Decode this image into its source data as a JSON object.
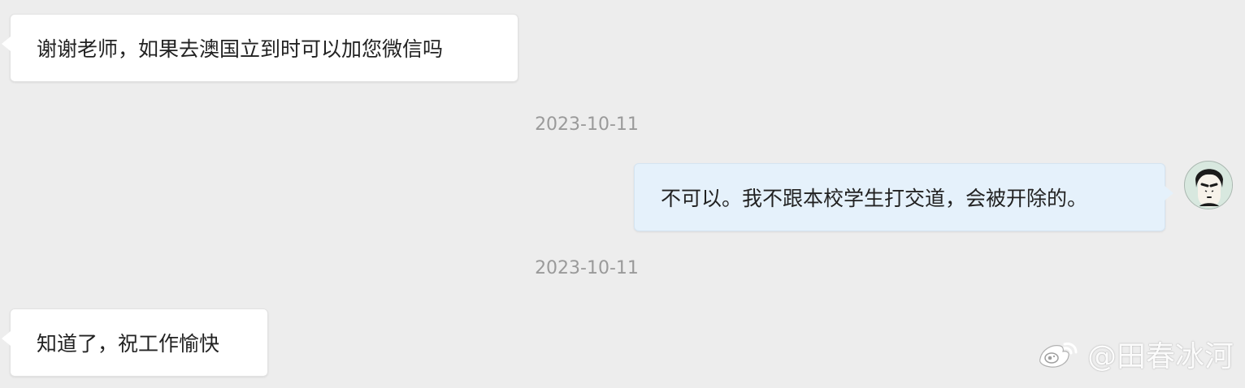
{
  "chat": {
    "messages": [
      {
        "text": "谢谢老师，如果去澳国立到时可以加您微信吗"
      },
      {
        "text": "不可以。我不跟本校学生打交道，会被开除的。"
      },
      {
        "text": "知道了，祝工作愉快"
      }
    ],
    "timestamps": [
      "2023-10-11",
      "2023-10-11"
    ]
  },
  "watermark": {
    "text": "@田春冰河"
  },
  "icons": {
    "avatar": "avatar-icon",
    "watermark": "weibo-icon"
  },
  "colors": {
    "background": "#ededed",
    "incoming_bubble": "#ffffff",
    "outgoing_bubble": "#e5f1fb",
    "timestamp": "#9a9a9a"
  }
}
